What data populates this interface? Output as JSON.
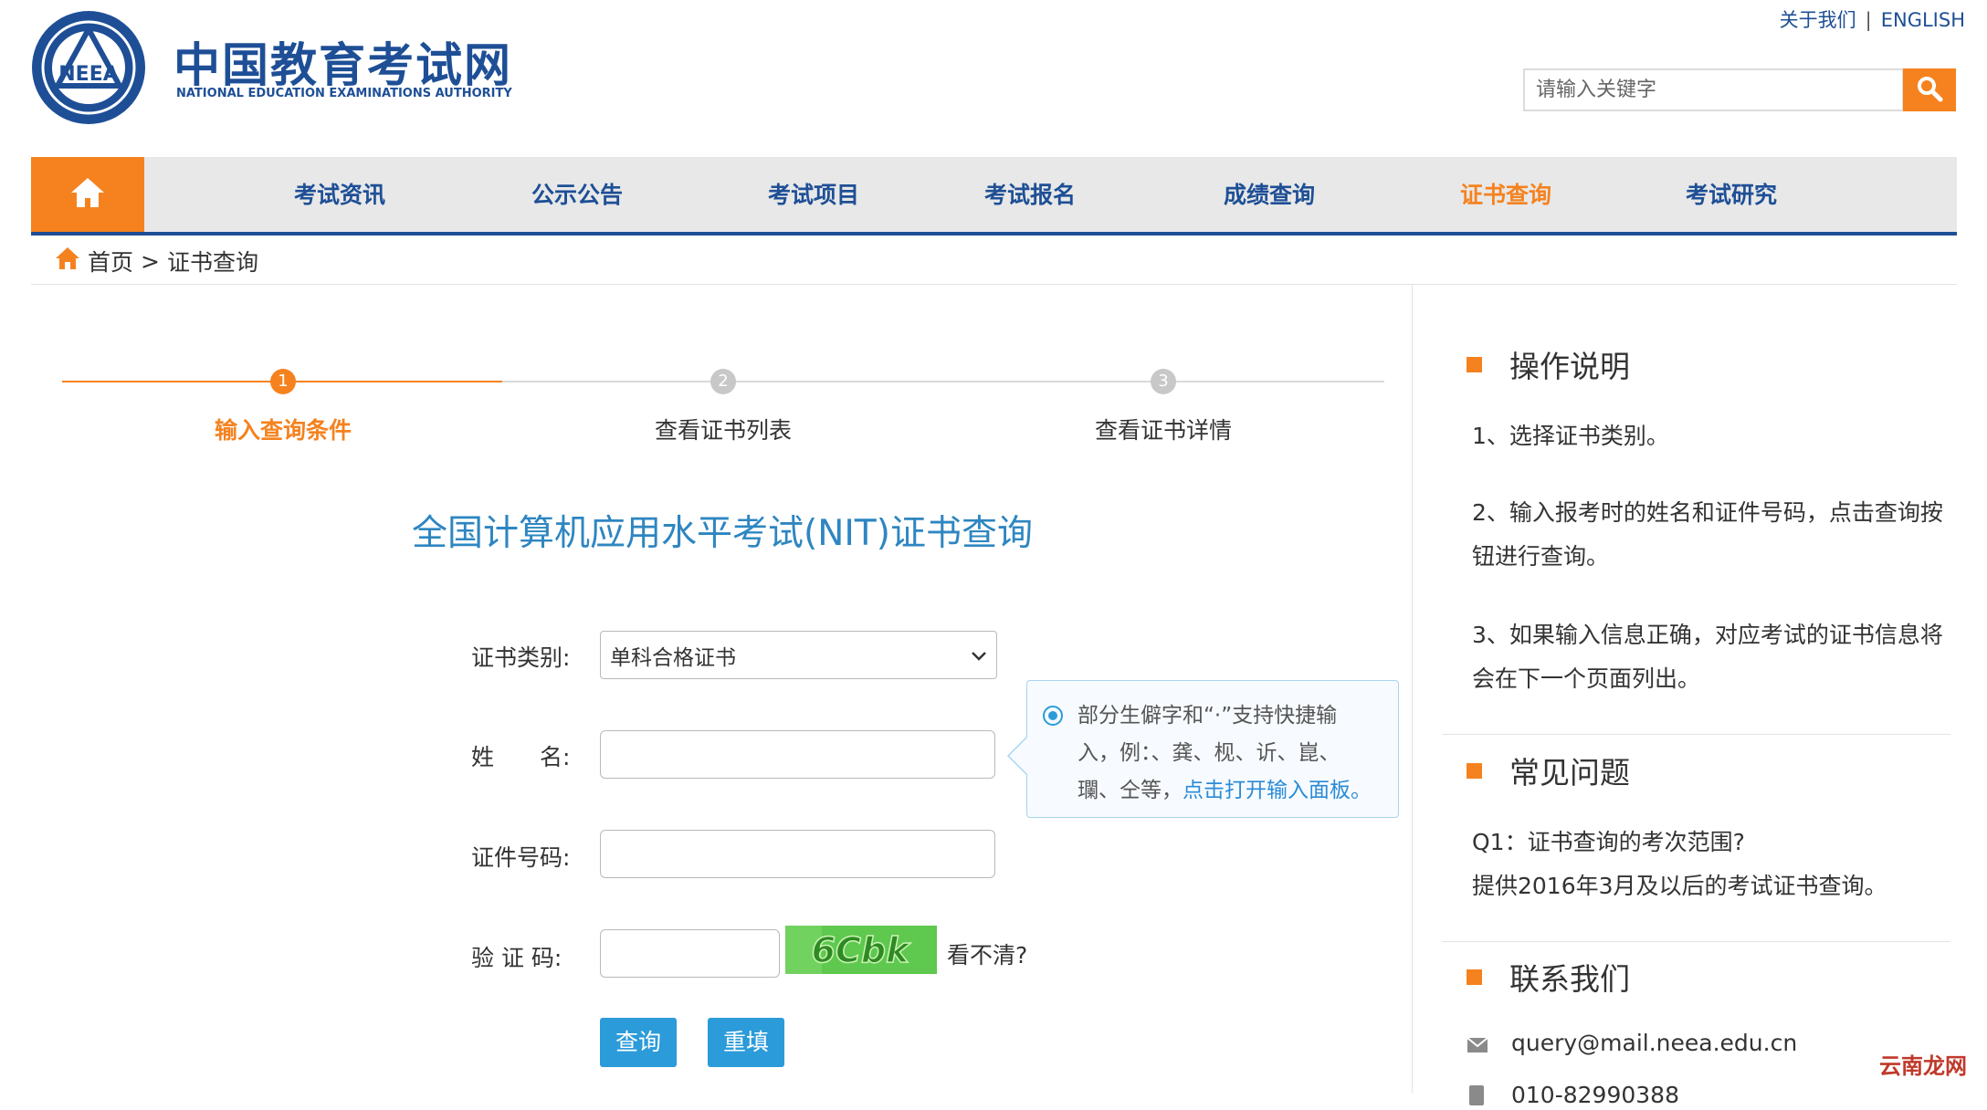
{
  "header": {
    "logo_cn": "中国教育考试网",
    "logo_en": "NATIONAL EDUCATION EXAMINATIONS AUTHORITY",
    "logo_emblem_text": "NEEA",
    "top_links": [
      "关于我们",
      "ENGLISH"
    ],
    "top_sep": "|",
    "search_placeholder": "请输入关键字"
  },
  "nav": {
    "items": [
      "考试资讯",
      "公示公告",
      "考试项目",
      "考试报名",
      "成绩查询",
      "证书查询",
      "考试研究"
    ],
    "active_index": 5
  },
  "breadcrumb": {
    "home": "首页",
    "sep": ">",
    "current": "证书查询"
  },
  "steps": [
    {
      "num": "1",
      "label": "输入查询条件",
      "active": true
    },
    {
      "num": "2",
      "label": "查看证书列表",
      "active": false
    },
    {
      "num": "3",
      "label": "查看证书详情",
      "active": false
    }
  ],
  "form": {
    "title": "全国计算机应用水平考试(NIT)证书查询",
    "cert_type_label": "证书类别:",
    "cert_type_value": "单科合格证书",
    "name_label": "姓　　名:",
    "name_value": "",
    "id_label": "证件号码:",
    "id_value": "",
    "captcha_label": "验 证 码:",
    "captcha_value": "",
    "captcha_image_text": "6Cbk",
    "captcha_refresh": "看不清?",
    "query_btn": "查询",
    "reset_btn": "重填"
  },
  "tooltip": {
    "line1": "部分生僻字和“·”支持快捷输",
    "line2": "入，例：、龚、枧、䜣、崑、",
    "line3_prefix": "瓓、仝等，",
    "link": "点击打开输入面板。"
  },
  "sidebar": {
    "ops_title": "操作说明",
    "ops_items": [
      "1、选择证书类别。",
      "2、输入报考时的姓名和证件号码，点击查询按钮进行查询。",
      "3、如果输入信息正确，对应考试的证书信息将会在下一个页面列出。"
    ],
    "faq_title": "常见问题",
    "faq_q": "Q1：证书查询的考次范围?",
    "faq_a": "提供2016年3月及以后的考试证书查询。",
    "contact_title": "联系我们",
    "contact_email": "query@mail.neea.edu.cn",
    "contact_phone": "010-82990388"
  },
  "watermark": "云南龙网",
  "colors": {
    "brand_blue": "#1e4f96",
    "accent_orange": "#f5821f",
    "link_blue": "#2b9bd9",
    "title_blue": "#2e86c1"
  }
}
